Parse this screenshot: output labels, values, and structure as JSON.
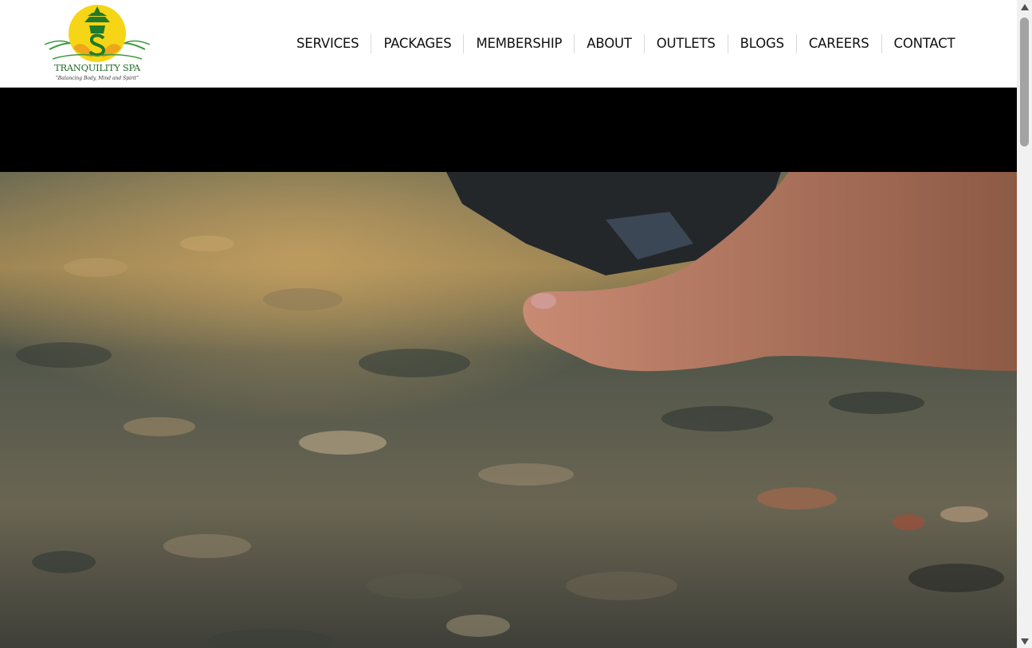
{
  "brand": {
    "name": "TRANQUILITY SPA",
    "tagline": "\"Balancing Body, Mind and Spirit\"",
    "colors": {
      "sun": "#f7d81c",
      "leaf": "#2e8b2e",
      "text": "#1f6b2a"
    }
  },
  "nav": {
    "items": [
      {
        "label": "SERVICES"
      },
      {
        "label": "PACKAGES"
      },
      {
        "label": "MEMBERSHIP"
      },
      {
        "label": "ABOUT"
      },
      {
        "label": "OUTLETS"
      },
      {
        "label": "BLOGS"
      },
      {
        "label": "CAREERS"
      },
      {
        "label": "CONTACT"
      }
    ]
  },
  "hero": {
    "media": "foot stepping into clear stream over pebbles",
    "letterbox_color": "#000000"
  },
  "scrollbar": {
    "up_icon": "scroll-up-arrow-icon",
    "down_icon": "scroll-down-arrow-icon"
  }
}
